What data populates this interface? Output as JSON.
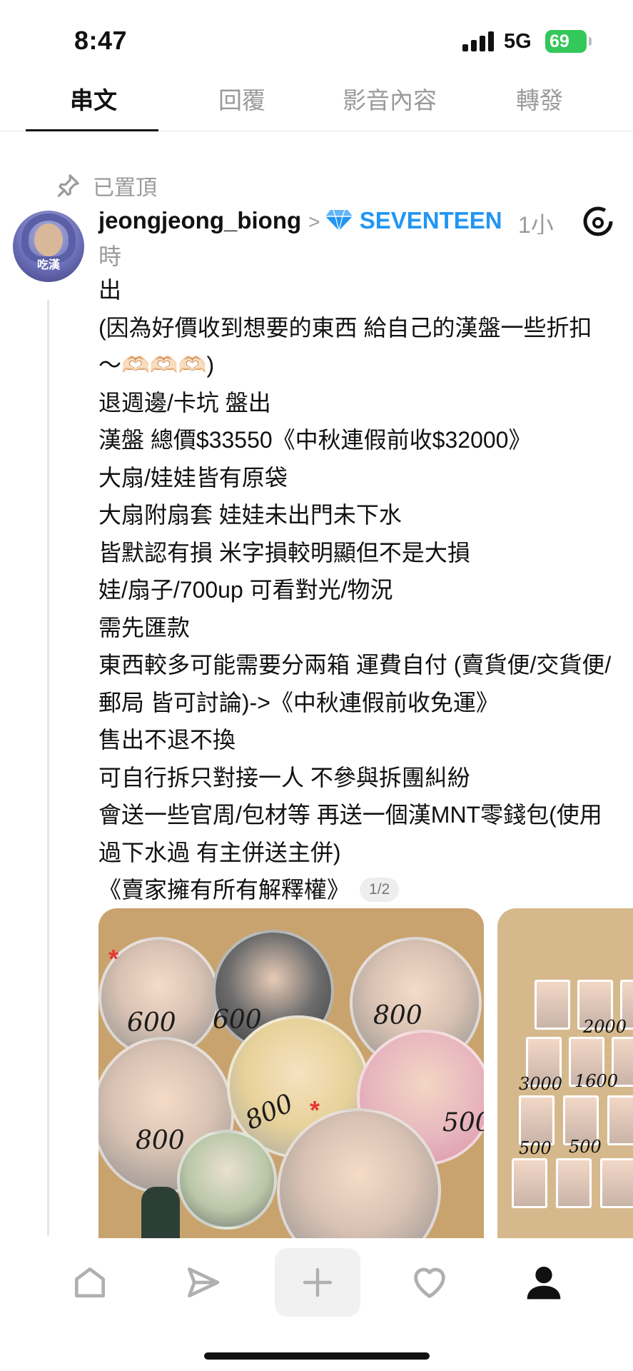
{
  "status_bar": {
    "time": "8:47",
    "network": "5G",
    "battery": "69"
  },
  "tabs": [
    {
      "label": "串文",
      "active": true
    },
    {
      "label": "回覆",
      "active": false
    },
    {
      "label": "影音內容",
      "active": false
    },
    {
      "label": "轉發",
      "active": false
    }
  ],
  "post": {
    "pinned_label": "已置頂",
    "avatar_label": "吃漢",
    "username": "jeongjeong_biong",
    "community": "SEVENTEEN",
    "time": "1小時",
    "lines": [
      "出",
      "(因為好價收到想要的東西 給自己的漢盤一些折扣～🫶🏻🫶🏻🫶🏻)",
      "退週邊/卡坑 盤出",
      "漢盤 總價$33550《中秋連假前收$32000》",
      "大扇/娃娃皆有原袋",
      "大扇附扇套 娃娃未出門未下水",
      "皆默認有損 米字損較明顯但不是大損",
      "娃/扇子/700up 可看對光/物況",
      "需先匯款",
      "東西較多可能需要分兩箱 運費自付 (賣貨便/交貨便/郵局 皆可討論)->《中秋連假前收免運》",
      "售出不退不換",
      "可自行拆只對接一人 不參與拆團糾紛",
      "會送一些官周/包材等 再送一個漢MNT零錢包(使用過下水過 有主併送主併)",
      "《賣家擁有所有解釋權》"
    ],
    "image_counter": "1/2",
    "image1_prices": [
      "600",
      "600",
      "800",
      "800",
      "800",
      "500"
    ],
    "image2_prices": [
      "2000",
      "3000",
      "1600",
      "500",
      "500"
    ]
  },
  "bottom_nav": [
    "home-icon",
    "send-icon",
    "plus-icon",
    "heart-icon",
    "profile-icon"
  ],
  "colors": {
    "accent": "#2196f3",
    "battery": "#34c759",
    "muted": "#9a9a9a"
  }
}
